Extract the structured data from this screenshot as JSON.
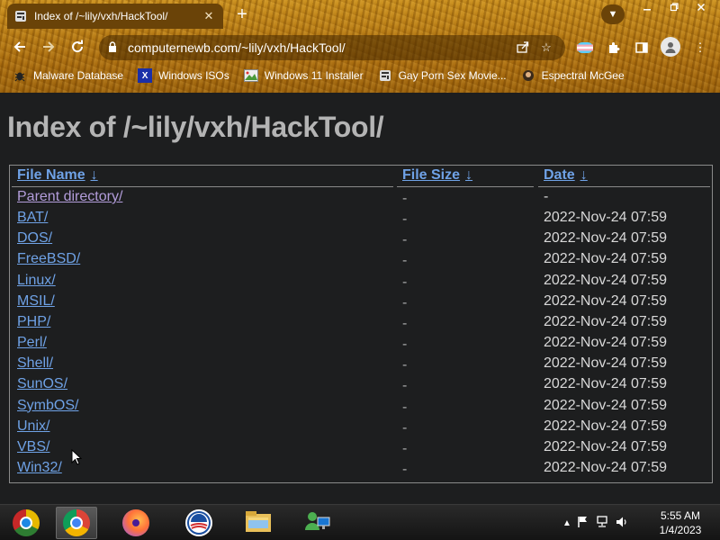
{
  "browser": {
    "tab": {
      "title": "Index of /~lily/vxh/HackTool/",
      "favicon": "ascii-art-icon"
    },
    "address": "computernewb.com/~lily/vxh/HackTool/",
    "theme_color": "#b57812"
  },
  "bookmarks": [
    {
      "label": "Malware Database",
      "icon": "bug-icon"
    },
    {
      "label": "Windows ISOs",
      "icon": "x-logo-icon"
    },
    {
      "label": "Windows 11 Installer",
      "icon": "image-icon"
    },
    {
      "label": "Gay Porn Sex Movie...",
      "icon": "ascii-art-icon"
    },
    {
      "label": "Espectral McGee",
      "icon": "avatar-icon"
    }
  ],
  "page": {
    "heading": "Index of /~lily/vxh/HackTool/",
    "columns": {
      "name": "File Name",
      "size": "File Size",
      "date": "Date",
      "sort_arrow": "↓"
    },
    "rows": [
      {
        "name": "Parent directory/",
        "size": "-",
        "date": "-"
      },
      {
        "name": "BAT/",
        "size": "-",
        "date": "2022-Nov-24 07:59"
      },
      {
        "name": "DOS/",
        "size": "-",
        "date": "2022-Nov-24 07:59"
      },
      {
        "name": "FreeBSD/",
        "size": "-",
        "date": "2022-Nov-24 07:59"
      },
      {
        "name": "Linux/",
        "size": "-",
        "date": "2022-Nov-24 07:59"
      },
      {
        "name": "MSIL/",
        "size": "-",
        "date": "2022-Nov-24 07:59"
      },
      {
        "name": "PHP/",
        "size": "-",
        "date": "2022-Nov-24 07:59"
      },
      {
        "name": "Perl/",
        "size": "-",
        "date": "2022-Nov-24 07:59"
      },
      {
        "name": "Shell/",
        "size": "-",
        "date": "2022-Nov-24 07:59"
      },
      {
        "name": "SunOS/",
        "size": "-",
        "date": "2022-Nov-24 07:59"
      },
      {
        "name": "SymbOS/",
        "size": "-",
        "date": "2022-Nov-24 07:59"
      },
      {
        "name": "Unix/",
        "size": "-",
        "date": "2022-Nov-24 07:59"
      },
      {
        "name": "VBS/",
        "size": "-",
        "date": "2022-Nov-24 07:59"
      },
      {
        "name": "Win32/",
        "size": "-",
        "date": "2022-Nov-24 07:59"
      }
    ],
    "colors": {
      "background": "#1d1e1f",
      "link": "#6fa2e6",
      "visited_link": "#b39ddb",
      "heading": "#b4b4b4"
    }
  },
  "taskbar": {
    "apps": [
      {
        "name": "chrome-canary-icon"
      },
      {
        "name": "chrome-icon",
        "active": true
      },
      {
        "name": "firefox-icon"
      },
      {
        "name": "obama-logo-icon"
      },
      {
        "name": "file-explorer-icon"
      },
      {
        "name": "network-users-icon"
      }
    ],
    "clock": {
      "time": "5:55 AM",
      "date": "1/4/2023"
    }
  }
}
